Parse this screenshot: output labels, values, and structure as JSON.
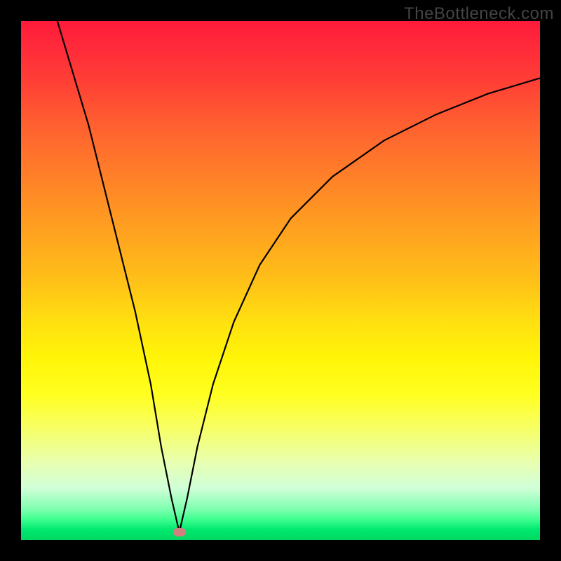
{
  "watermark": "TheBottleneck.com",
  "chart_data": {
    "type": "line",
    "title": "",
    "xlabel": "",
    "ylabel": "",
    "x_range": [
      0,
      100
    ],
    "y_range": [
      0,
      100
    ],
    "minimum_point": {
      "x": 30.5,
      "y": 1.5
    },
    "curve_left": [
      {
        "x": 7,
        "y": 100
      },
      {
        "x": 10,
        "y": 90
      },
      {
        "x": 13,
        "y": 80
      },
      {
        "x": 16,
        "y": 68
      },
      {
        "x": 19,
        "y": 56
      },
      {
        "x": 22,
        "y": 44
      },
      {
        "x": 25,
        "y": 30
      },
      {
        "x": 27,
        "y": 18
      },
      {
        "x": 29,
        "y": 8
      },
      {
        "x": 30.5,
        "y": 1.5
      }
    ],
    "curve_right": [
      {
        "x": 30.5,
        "y": 1.5
      },
      {
        "x": 32,
        "y": 8
      },
      {
        "x": 34,
        "y": 18
      },
      {
        "x": 37,
        "y": 30
      },
      {
        "x": 41,
        "y": 42
      },
      {
        "x": 46,
        "y": 53
      },
      {
        "x": 52,
        "y": 62
      },
      {
        "x": 60,
        "y": 70
      },
      {
        "x": 70,
        "y": 77
      },
      {
        "x": 80,
        "y": 82
      },
      {
        "x": 90,
        "y": 86
      },
      {
        "x": 100,
        "y": 89
      }
    ],
    "marker": {
      "x": 30.5,
      "y": 1.5,
      "color": "#d08080"
    },
    "annotations": []
  }
}
